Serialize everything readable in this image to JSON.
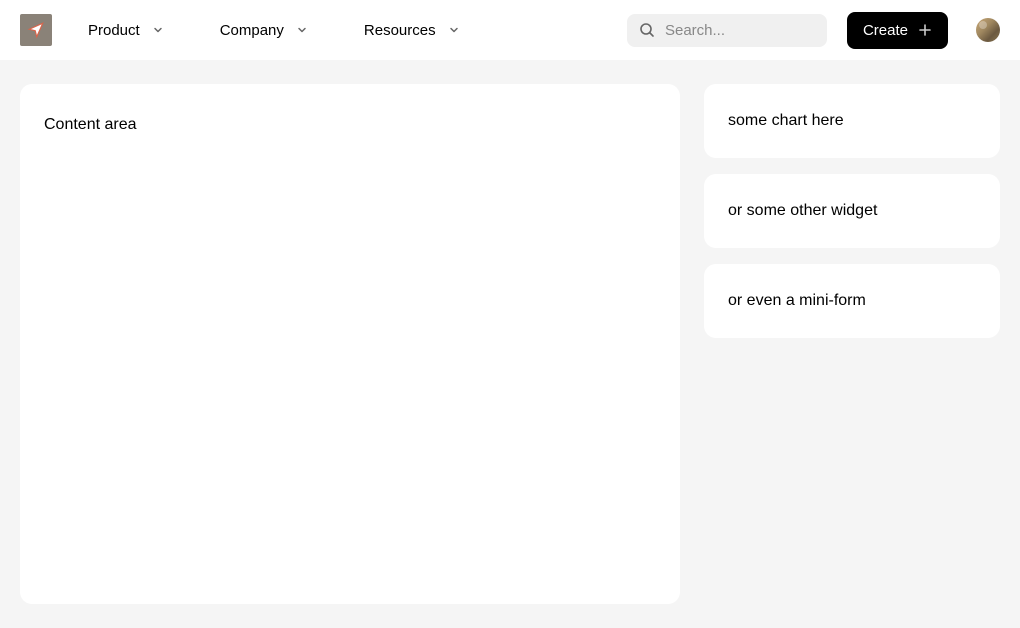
{
  "header": {
    "nav": [
      {
        "label": "Product"
      },
      {
        "label": "Company"
      },
      {
        "label": "Resources"
      }
    ],
    "search": {
      "placeholder": "Search..."
    },
    "create_label": "Create"
  },
  "main": {
    "title": "Content area"
  },
  "widgets": [
    {
      "text": "some chart here"
    },
    {
      "text": "or some other widget"
    },
    {
      "text": "or even a mini-form"
    }
  ]
}
